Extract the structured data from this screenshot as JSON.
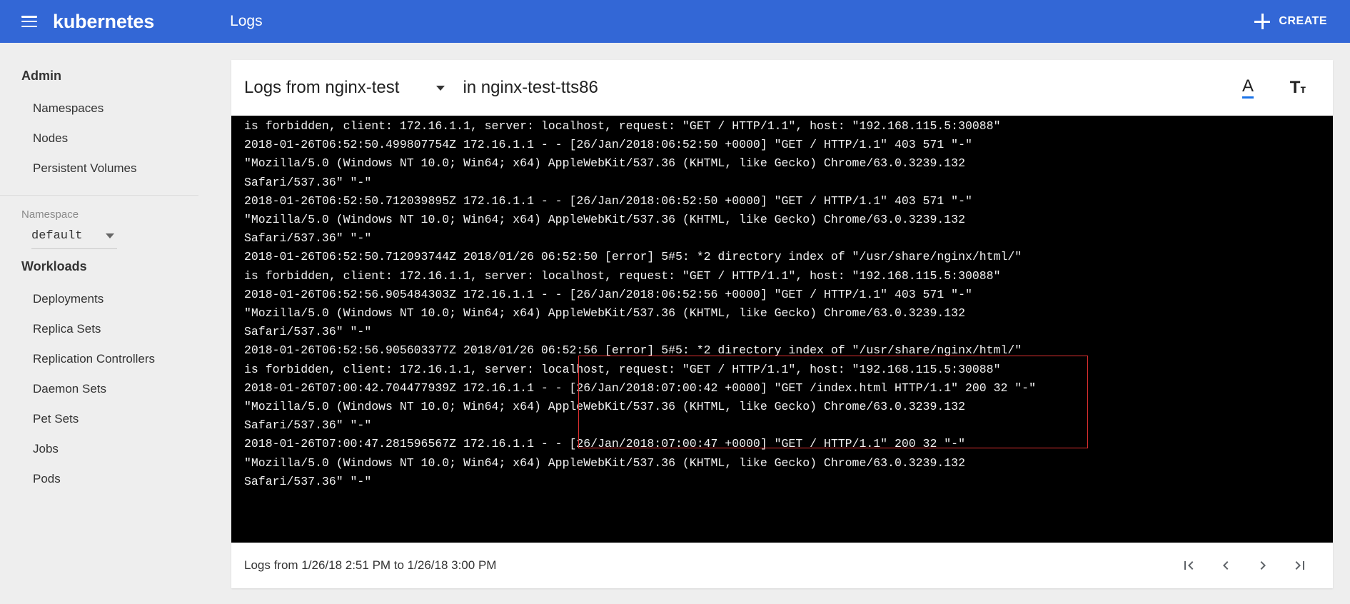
{
  "topbar": {
    "menu_icon": "hamburger-menu-icon",
    "brand": "kubernetes",
    "page_title": "Logs",
    "create_label": "CREATE",
    "plus_icon": "plus-icon",
    "accent_color": "#3367d6"
  },
  "sidebar": {
    "admin_title": "Admin",
    "admin_items": [
      "Namespaces",
      "Nodes",
      "Persistent Volumes"
    ],
    "namespace_label": "Namespace",
    "namespace_value": "default",
    "workloads_title": "Workloads",
    "workload_items": [
      "Deployments",
      "Replica Sets",
      "Replication Controllers",
      "Daemon Sets",
      "Pet Sets",
      "Jobs",
      "Pods"
    ]
  },
  "card": {
    "logs_from_label": "Logs from nginx-test",
    "in_container_label": "in nginx-test-tts86",
    "color_toggle_icon": "text-color-icon",
    "color_toggle_glyph": "A",
    "font_size_icon": "font-size-icon",
    "font_size_glyph_large": "T",
    "font_size_glyph_small": "т",
    "accent_underline": "#1a73e8"
  },
  "log": {
    "text": "is forbidden, client: 172.16.1.1, server: localhost, request: \"GET / HTTP/1.1\", host: \"192.168.115.5:30088\"\n2018-01-26T06:52:50.499807754Z 172.16.1.1 - - [26/Jan/2018:06:52:50 +0000] \"GET / HTTP/1.1\" 403 571 \"-\"\n\"Mozilla/5.0 (Windows NT 10.0; Win64; x64) AppleWebKit/537.36 (KHTML, like Gecko) Chrome/63.0.3239.132\nSafari/537.36\" \"-\"\n2018-01-26T06:52:50.712039895Z 172.16.1.1 - - [26/Jan/2018:06:52:50 +0000] \"GET / HTTP/1.1\" 403 571 \"-\"\n\"Mozilla/5.0 (Windows NT 10.0; Win64; x64) AppleWebKit/537.36 (KHTML, like Gecko) Chrome/63.0.3239.132\nSafari/537.36\" \"-\"\n2018-01-26T06:52:50.712093744Z 2018/01/26 06:52:50 [error] 5#5: *2 directory index of \"/usr/share/nginx/html/\"\nis forbidden, client: 172.16.1.1, server: localhost, request: \"GET / HTTP/1.1\", host: \"192.168.115.5:30088\"\n2018-01-26T06:52:56.905484303Z 172.16.1.1 - - [26/Jan/2018:06:52:56 +0000] \"GET / HTTP/1.1\" 403 571 \"-\"\n\"Mozilla/5.0 (Windows NT 10.0; Win64; x64) AppleWebKit/537.36 (KHTML, like Gecko) Chrome/63.0.3239.132\nSafari/537.36\" \"-\"\n2018-01-26T06:52:56.905603377Z 2018/01/26 06:52:56 [error] 5#5: *2 directory index of \"/usr/share/nginx/html/\"\nis forbidden, client: 172.16.1.1, server: localhost, request: \"GET / HTTP/1.1\", host: \"192.168.115.5:30088\"\n2018-01-26T07:00:42.704477939Z 172.16.1.1 - - [26/Jan/2018:07:00:42 +0000] \"GET /index.html HTTP/1.1\" 200 32 \"-\"\n\"Mozilla/5.0 (Windows NT 10.0; Win64; x64) AppleWebKit/537.36 (KHTML, like Gecko) Chrome/63.0.3239.132\nSafari/537.36\" \"-\"\n2018-01-26T07:00:47.281596567Z 172.16.1.1 - - [26/Jan/2018:07:00:47 +0000] \"GET / HTTP/1.1\" 200 32 \"-\"\n\"Mozilla/5.0 (Windows NT 10.0; Win64; x64) AppleWebKit/537.36 (KHTML, like Gecko) Chrome/63.0.3239.132\nSafari/537.36\" \"-\"",
    "annotation_color": "#e03030"
  },
  "footer": {
    "range_text": "Logs from 1/26/18 2:51 PM to 1/26/18 3:00 PM",
    "first_icon": "first-page-icon",
    "prev_icon": "previous-page-icon",
    "next_icon": "next-page-icon",
    "last_icon": "last-page-icon"
  }
}
